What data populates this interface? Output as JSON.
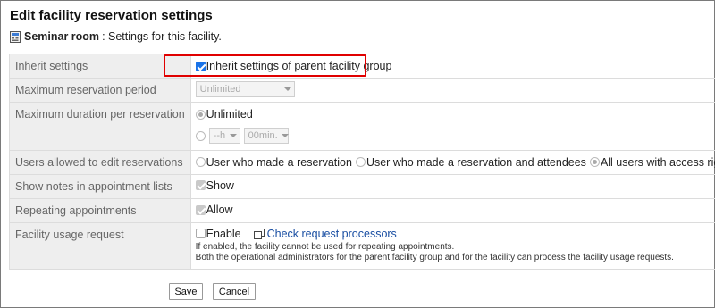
{
  "page": {
    "title": "Edit facility reservation settings",
    "facility_name": "Seminar room",
    "facility_suffix": ": Settings for this facility."
  },
  "settings": {
    "inherit": {
      "label": "Inherit settings",
      "checkbox_label": "Inherit settings of parent facility group",
      "checked": true
    },
    "max_period": {
      "label": "Maximum reservation period",
      "select_value": "Unlimited"
    },
    "max_duration": {
      "label": "Maximum duration per reservation",
      "option_unlimited": "Unlimited",
      "hours_value": "--h",
      "minutes_value": "00min."
    },
    "edit_permission": {
      "label": "Users allowed to edit reservations",
      "options": [
        "User who made a reservation",
        "User who made a reservation and attendees",
        "All users with access rights"
      ],
      "selected": "All users with access rights"
    },
    "show_notes": {
      "label": "Show notes in appointment lists",
      "checkbox_label": "Show",
      "checked": true
    },
    "repeating": {
      "label": "Repeating appointments",
      "checkbox_label": "Allow",
      "checked": true
    },
    "usage_request": {
      "label": "Facility usage request",
      "checkbox_label": "Enable",
      "checked": false,
      "link_label": "Check request processors",
      "note_line1": "If enabled, the facility cannot be used for repeating appointments.",
      "note_line2": "Both the operational administrators for the parent facility group and for the facility can process the facility usage requests."
    }
  },
  "buttons": {
    "save": "Save",
    "cancel": "Cancel"
  },
  "colors": {
    "highlight": "#e00000",
    "link": "#1a4fa3",
    "label_bg": "#eeeeee",
    "checkbox_checked": "#1a73e8"
  },
  "icons": {
    "facility": "facility-room-icon",
    "copy": "copy-icon"
  }
}
